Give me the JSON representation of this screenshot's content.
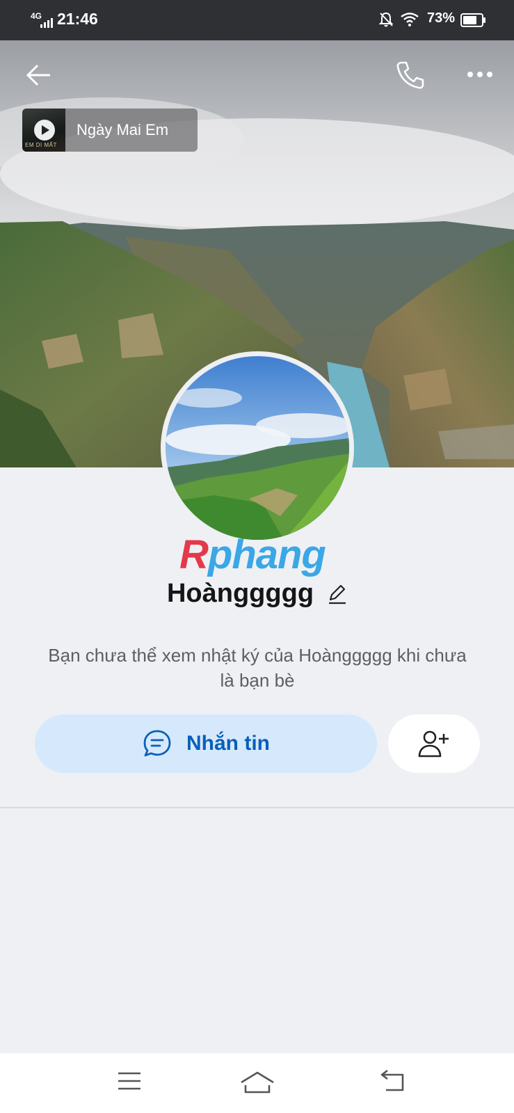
{
  "status_bar": {
    "network": "4G",
    "time": "21:46",
    "battery": "73%"
  },
  "music": {
    "title": "Ngày Mai Em",
    "cover_text": "EM DI MẤT"
  },
  "profile": {
    "name": "Hoànggggg",
    "watermark_r": "R",
    "watermark_rest": "phang"
  },
  "notice": {
    "text": "Bạn chưa thể xem nhật ký của Hoànggggg khi chưa là bạn bè"
  },
  "actions": {
    "message_label": "Nhắn tin"
  },
  "icons": [
    "back-arrow-icon",
    "phone-icon",
    "more-icon",
    "edit-icon",
    "chat-bubble-icon",
    "add-friend-icon",
    "menu-icon",
    "home-icon",
    "return-icon"
  ],
  "colors": {
    "accent": "#0a5fb8",
    "button_bg": "#d6e9fc",
    "page_bg": "#eff0f4"
  }
}
